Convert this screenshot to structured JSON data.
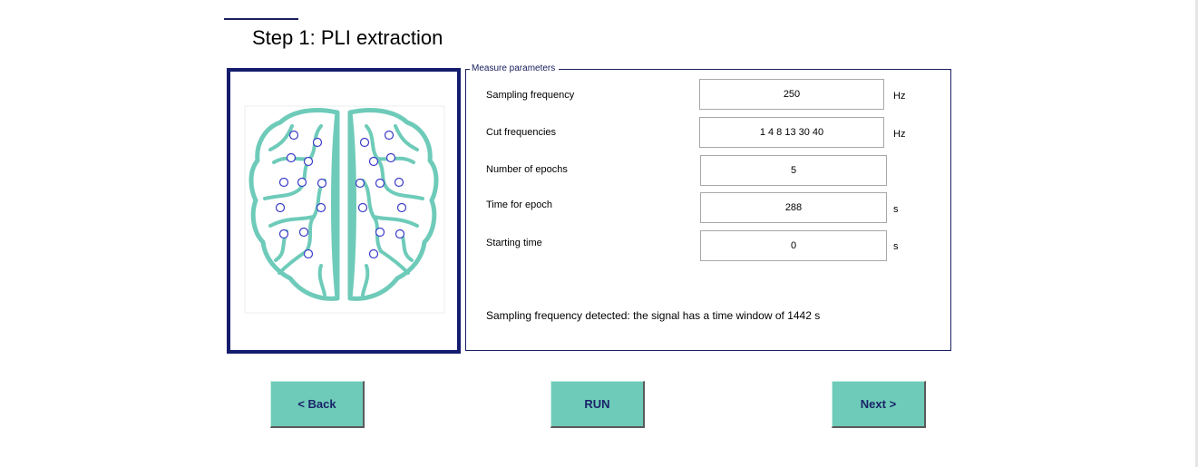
{
  "page": {
    "title": "Step 1: PLI extraction"
  },
  "panel": {
    "legend": "Measure parameters",
    "params": [
      {
        "label": "Sampling frequency",
        "value": "250",
        "unit": "Hz"
      },
      {
        "label": "Cut frequencies",
        "value": "1 4 8 13 30 40",
        "unit": "Hz"
      },
      {
        "label": "Number of epochs",
        "value": "5",
        "unit": ""
      },
      {
        "label": "Time for epoch",
        "value": "288",
        "unit": "s"
      },
      {
        "label": "Starting time",
        "value": "0",
        "unit": "s"
      }
    ],
    "status": "Sampling frequency detected: the signal has a time window of 1442 s"
  },
  "buttons": {
    "back": "<  Back",
    "run": "RUN",
    "next": "Next  >"
  },
  "image": {
    "name": "brain-electrode-map"
  },
  "colors": {
    "accent": "#6ecbb9",
    "frame": "#141c6e",
    "button_text": "#1a2468",
    "brain": "#6ecbb9",
    "electrode": "#3a3ac8"
  }
}
